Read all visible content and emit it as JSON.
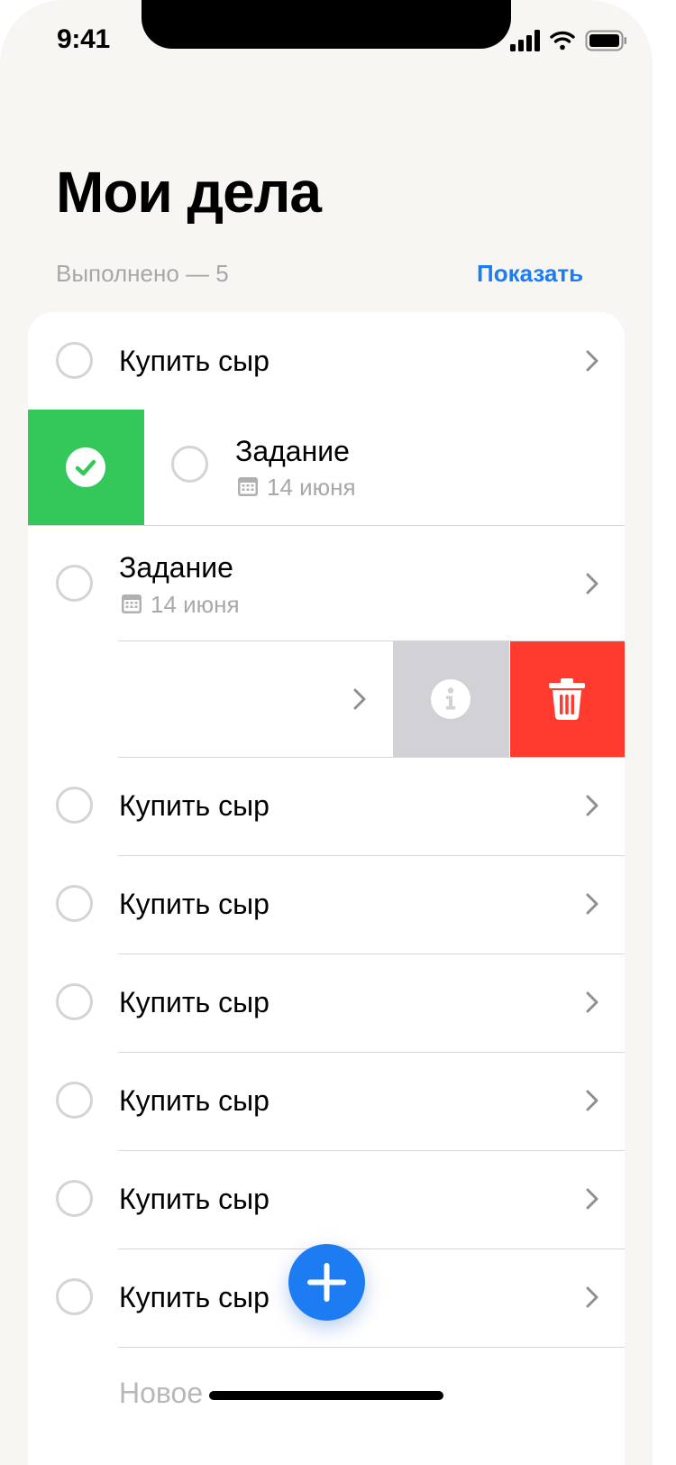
{
  "status_bar": {
    "time": "9:41",
    "icons": [
      "cellular-signal-icon",
      "wifi-icon",
      "battery-icon"
    ]
  },
  "header": {
    "title": "Мои дела",
    "done_count_label": "Выполнено — 5",
    "show_button": "Показать"
  },
  "tasks": [
    {
      "title": "Купить сыр"
    },
    {
      "title": "Задание",
      "date": "14 июня",
      "state": "swiped-right",
      "swipe_action": "mark-done"
    },
    {
      "title": "Задание",
      "date": "14 июня"
    },
    {
      "title": "",
      "state": "swiped-left",
      "swipe_actions": [
        "info",
        "delete"
      ]
    },
    {
      "title": "Купить сыр"
    },
    {
      "title": "Купить сыр"
    },
    {
      "title": "Купить сыр"
    },
    {
      "title": "Купить сыр"
    },
    {
      "title": "Купить сыр"
    },
    {
      "title": "Купить сыр"
    }
  ],
  "new_item_placeholder": "Новое",
  "fab_icon": "plus-icon",
  "colors": {
    "background": "#F7F6F2",
    "accent": "#1E7CF2",
    "done_green": "#34C759",
    "delete_red": "#FF3B30",
    "info_gray": "#D1D1D6"
  }
}
